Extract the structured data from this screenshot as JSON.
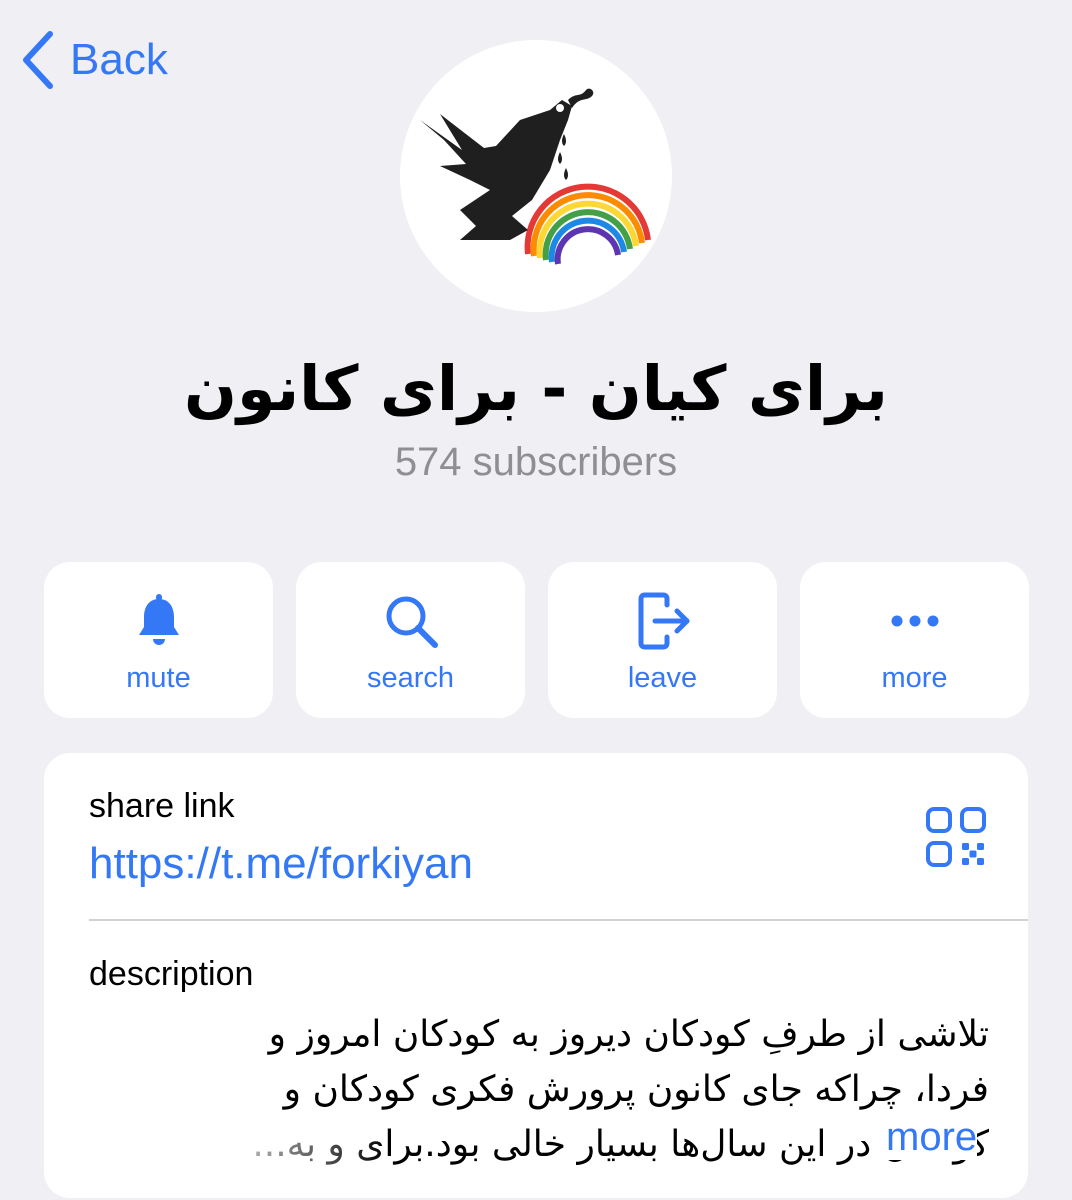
{
  "nav": {
    "back_label": "Back"
  },
  "channel": {
    "title": "برای کیان - برای کانون",
    "subscribers": "574 subscribers"
  },
  "actions": [
    {
      "label": "mute",
      "icon": "bell-icon"
    },
    {
      "label": "search",
      "icon": "search-icon"
    },
    {
      "label": "leave",
      "icon": "leave-icon"
    },
    {
      "label": "more",
      "icon": "more-dots-icon"
    }
  ],
  "share": {
    "label": "share link",
    "url": "https://t.me/forkiyan",
    "icon": "qr-code-icon"
  },
  "description": {
    "label": "description",
    "lines": [
      "تلاشی از طرفِ کودکان دیروز به کودکان امروز و",
      "فردا، چراکه جای کانون پرورش فکری کودکان و",
      "کودکان در این سال‌ها بسیار خالی بود.برای و به..."
    ],
    "more_label": "more"
  },
  "colors": {
    "accent": "#3478f6",
    "background": "#efeff4",
    "secondary_text": "#8e8e93"
  }
}
